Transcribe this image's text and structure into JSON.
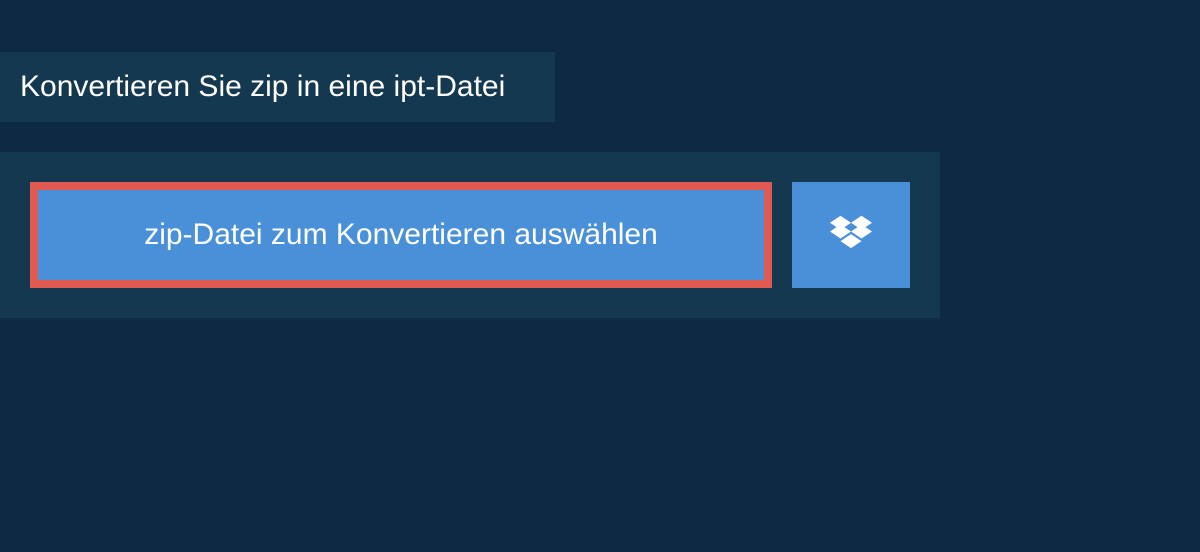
{
  "header": {
    "title": "Konvertieren Sie zip in eine ipt-Datei"
  },
  "actions": {
    "select_label": "zip-Datei zum Konvertieren auswählen"
  },
  "colors": {
    "bg_dark": "#0e2a42",
    "bg_panel": "#143850",
    "button_blue": "#4a90d9",
    "highlight_red": "#e05a52"
  }
}
